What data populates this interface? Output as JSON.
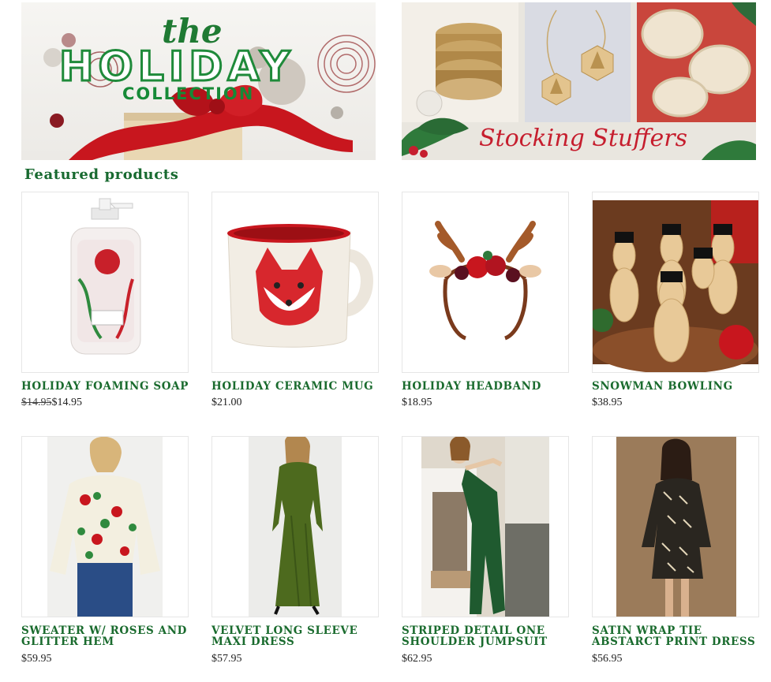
{
  "banners": {
    "holiday": {
      "line1": "the",
      "line2": "HOLIDAY",
      "line3": "COLLECTION"
    },
    "stuffers": {
      "caption": "Stocking Stuffers"
    }
  },
  "featured": {
    "title": "Featured products",
    "products": [
      {
        "name": "HOLIDAY FOAMING SOAP",
        "old_price": "$14.95",
        "price": "$14.95"
      },
      {
        "name": "HOLIDAY CERAMIC MUG",
        "price": "$21.00"
      },
      {
        "name": "HOLIDAY HEADBAND",
        "price": "$18.95"
      },
      {
        "name": "SNOWMAN BOWLING",
        "price": "$38.95"
      },
      {
        "name": "SWEATER W/ ROSES AND GLITTER HEM",
        "price": "$59.95"
      },
      {
        "name": "VELVET LONG SLEEVE MAXI DRESS",
        "price": "$57.95"
      },
      {
        "name": "STRIPED DETAIL ONE SHOULDER JUMPSUIT",
        "price": "$62.95"
      },
      {
        "name": "SATIN WRAP TIE ABSTARCT PRINT DRESS",
        "price": "$56.95"
      }
    ]
  },
  "colors": {
    "heading_green": "#186a30",
    "product_name_green": "#1a6b2e",
    "ribbon_red": "#c8161e",
    "price_text": "#222222"
  },
  "icons": {
    "products": [
      "soap-bottle",
      "fox-mug",
      "reindeer-headband",
      "snowman-pins",
      "rose-sweater",
      "velvet-dress",
      "green-jumpsuit",
      "print-dress"
    ]
  }
}
